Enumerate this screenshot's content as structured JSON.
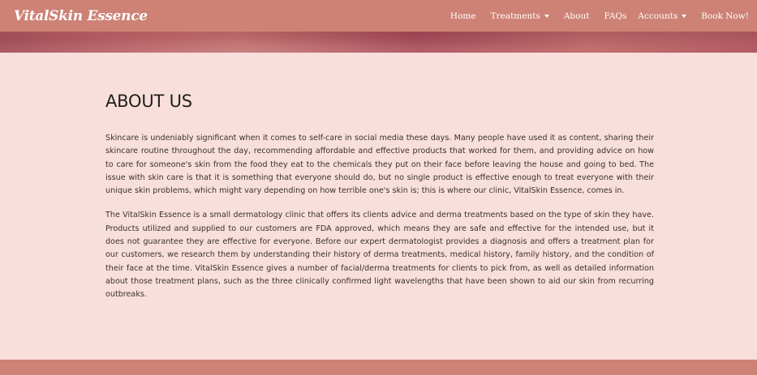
{
  "navbar": {
    "brand": "VitalSkin Essence",
    "items": [
      {
        "label": "Home",
        "dropdown": false
      },
      {
        "label": "Treatments",
        "dropdown": true
      },
      {
        "label": "About",
        "dropdown": false
      },
      {
        "label": "FAQs",
        "dropdown": false
      },
      {
        "label": "Accounts",
        "dropdown": true
      },
      {
        "label": "Book Now!",
        "dropdown": false
      }
    ]
  },
  "about": {
    "heading": "ABOUT US",
    "paragraph1": "Skincare is undeniably significant when it comes to self-care in social media these days. Many people have used it as content, sharing their skincare routine throughout the day, recommending affordable and effective products that worked for them, and providing advice on how to care for someone's skin from the food they eat to the chemicals they put on their face before leaving the house and going to bed. The issue with skin care is that it is something that everyone should do, but no single product is effective enough to treat everyone with their unique skin problems, which might vary depending on how terrible one's skin is; this is where our clinic, VitalSkin Essence, comes in.",
    "paragraph2": "The VitalSkin Essence is a small dermatology clinic that offers its clients advice and derma treatments based on the type of skin they have. Products utilized and supplied to our customers are FDA approved, which means they are safe and effective for the intended use, but it does not guarantee they are effective for everyone. Before our expert dermatologist provides a diagnosis and offers a treatment plan for our customers, we research them by understanding their history of derma treatments, medical history, family history, and the condition of their face at the time. VitalSkin Essence gives a number of facial/derma treatments for clients to pick from, as well as detailed information about those treatment plans, such as the three clinically confirmed light wavelengths that have been shown to aid our skin from recurring outbreaks."
  },
  "colors": {
    "navbar": "#cd8275",
    "page_background": "#f9dfdb",
    "hero": "#b35c63"
  }
}
